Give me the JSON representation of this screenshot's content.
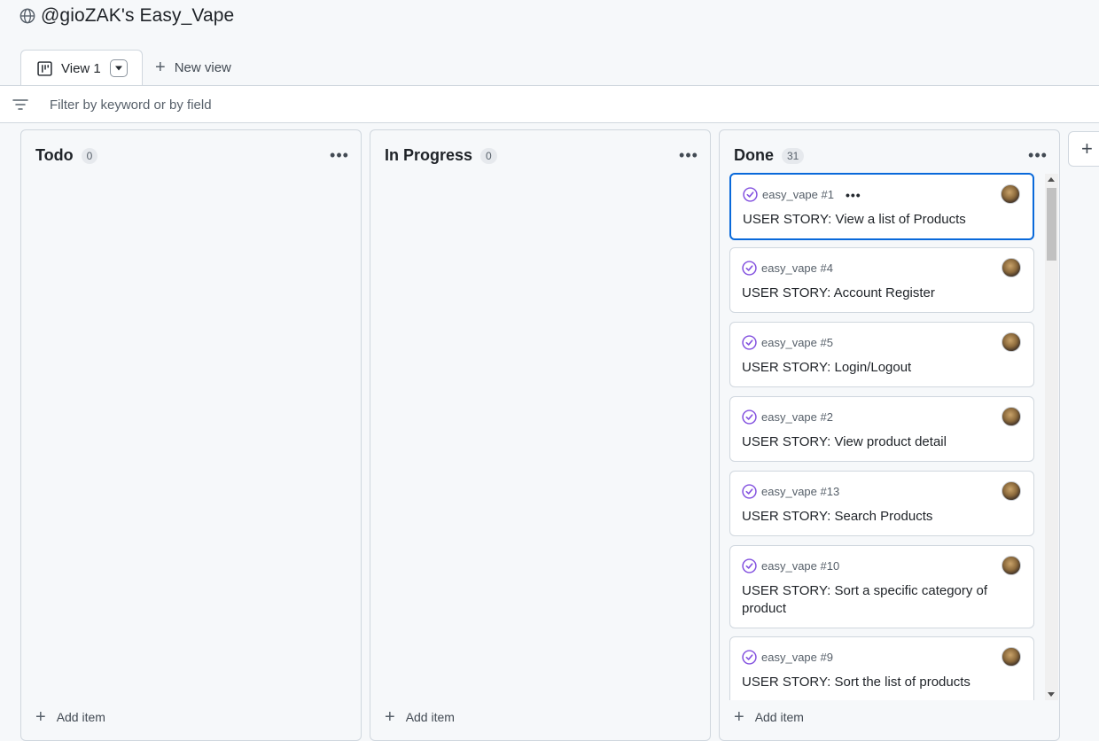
{
  "page": {
    "title": "@gioZAK's Easy_Vape"
  },
  "tabs": [
    {
      "label": "View 1",
      "active": true
    },
    {
      "label": "New view"
    }
  ],
  "filter": {
    "placeholder": "Filter by keyword or by field"
  },
  "columns": [
    {
      "title": "Todo",
      "count": "0",
      "add_label": "Add item",
      "menu_icon": "kebab-horizontal-icon"
    },
    {
      "title": "In Progress",
      "count": "0",
      "add_label": "Add item",
      "menu_icon": "kebab-horizontal-icon"
    },
    {
      "title": "Done",
      "count": "31",
      "add_label": "Add item",
      "menu_icon": "kebab-horizontal-icon",
      "cards": [
        {
          "repo": "easy_vape #1",
          "title": "USER STORY: View a list of Products",
          "status_icon": "issue-closed-icon",
          "selected": true
        },
        {
          "repo": "easy_vape #4",
          "title": "USER STORY: Account Register",
          "status_icon": "issue-closed-icon"
        },
        {
          "repo": "easy_vape #5",
          "title": "USER STORY: Login/Logout",
          "status_icon": "issue-closed-icon"
        },
        {
          "repo": "easy_vape #2",
          "title": "USER STORY: View product detail",
          "status_icon": "issue-closed-icon"
        },
        {
          "repo": "easy_vape #13",
          "title": "USER STORY: Search Products",
          "status_icon": "issue-closed-icon"
        },
        {
          "repo": "easy_vape #10",
          "title": "USER STORY: Sort a specific category of product",
          "status_icon": "issue-closed-icon"
        },
        {
          "repo": "easy_vape #9",
          "title": "USER STORY: Sort the list of products",
          "status_icon": "issue-closed-icon"
        }
      ]
    }
  ],
  "colors": {
    "accent": "#0969da",
    "closed_purple": "#8250df",
    "border": "#d0d7de",
    "background": "#f6f8fa"
  },
  "icons": {
    "title": "globe-icon",
    "tab": "project-board-icon",
    "filter": "filter-icon",
    "add": "plus-icon"
  }
}
